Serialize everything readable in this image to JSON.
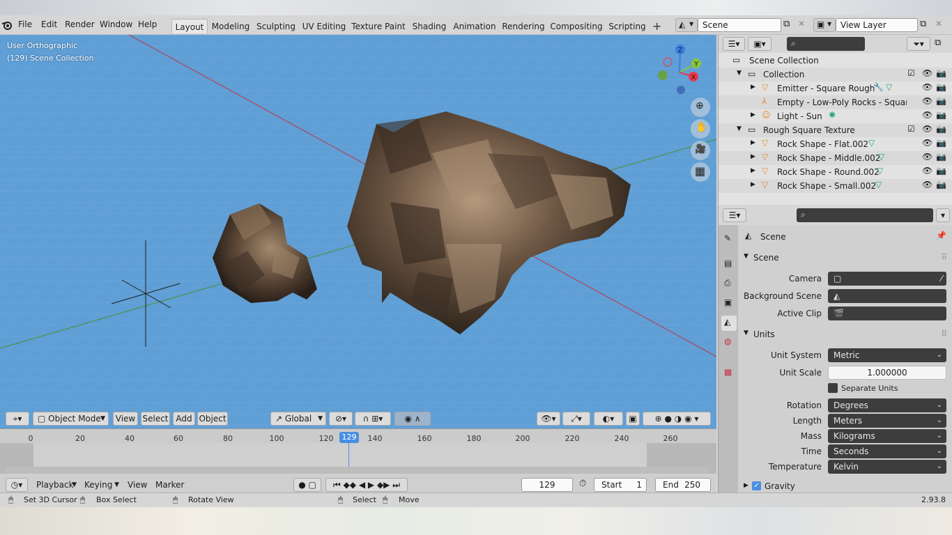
{
  "menus": [
    "File",
    "Edit",
    "Render",
    "Window",
    "Help"
  ],
  "tabs": [
    "Layout",
    "Modeling",
    "Sculpting",
    "UV Editing",
    "Texture Paint",
    "Shading",
    "Animation",
    "Rendering",
    "Compositing",
    "Scripting"
  ],
  "scene_field": "Scene",
  "view_layer_field": "View Layer",
  "viewport": {
    "view_name": "User Orthographic",
    "collection_info": "(129) Scene Collection"
  },
  "header": {
    "mode": "Object Mode",
    "menus": [
      "View",
      "Select",
      "Add",
      "Object"
    ],
    "transform": "Global"
  },
  "timeline": {
    "ticks": [
      "0",
      "20",
      "40",
      "60",
      "80",
      "100",
      "120",
      "129",
      "140",
      "160",
      "180",
      "200",
      "220",
      "240",
      "260"
    ],
    "current_frame": "129",
    "playback": "Playback",
    "keying": "Keying",
    "view": "View",
    "marker": "Marker",
    "frame_field": "129",
    "start_label": "Start",
    "start_value": "1",
    "end_label": "End",
    "end_value": "250"
  },
  "status": {
    "set_cursor": "Set 3D Cursor",
    "box_select": "Box Select",
    "rotate_view": "Rotate View",
    "select": "Select",
    "move": "Move",
    "version": "2.93.8"
  },
  "outliner": {
    "root": "Scene Collection",
    "rows": [
      {
        "label": "Collection"
      },
      {
        "label": "Emitter - Square Rough"
      },
      {
        "label": "Empty - Low-Poly Rocks - Square - Rc"
      },
      {
        "label": "Light - Sun"
      },
      {
        "label": "Rough Square Texture"
      },
      {
        "label": "Rock Shape - Flat.002"
      },
      {
        "label": "Rock Shape - Middle.002"
      },
      {
        "label": "Rock Shape - Round.002"
      },
      {
        "label": "Rock Shape - Small.002"
      }
    ]
  },
  "properties": {
    "context": "Scene",
    "scene_section": "Scene",
    "camera_label": "Camera",
    "bg_scene_label": "Background Scene",
    "active_clip_label": "Active Clip",
    "units_section": "Units",
    "unit_system_label": "Unit System",
    "unit_system": "Metric",
    "unit_scale_label": "Unit Scale",
    "unit_scale": "1.000000",
    "separate_units": "Separate Units",
    "rotation_label": "Rotation",
    "rotation": "Degrees",
    "length_label": "Length",
    "length": "Meters",
    "mass_label": "Mass",
    "mass": "Kilograms",
    "time_label": "Time",
    "time": "Seconds",
    "temperature_label": "Temperature",
    "temperature": "Kelvin",
    "gravity_section": "Gravity"
  },
  "gizmo_axes": [
    "Z",
    "Y",
    "X"
  ],
  "colors": {
    "viewport_bg": "#5f9fd6",
    "x_axis": "#e8384c",
    "y_axis": "#8cc43c",
    "z_axis": "#3b7ee0",
    "current_frame": "#4a8fe0"
  }
}
